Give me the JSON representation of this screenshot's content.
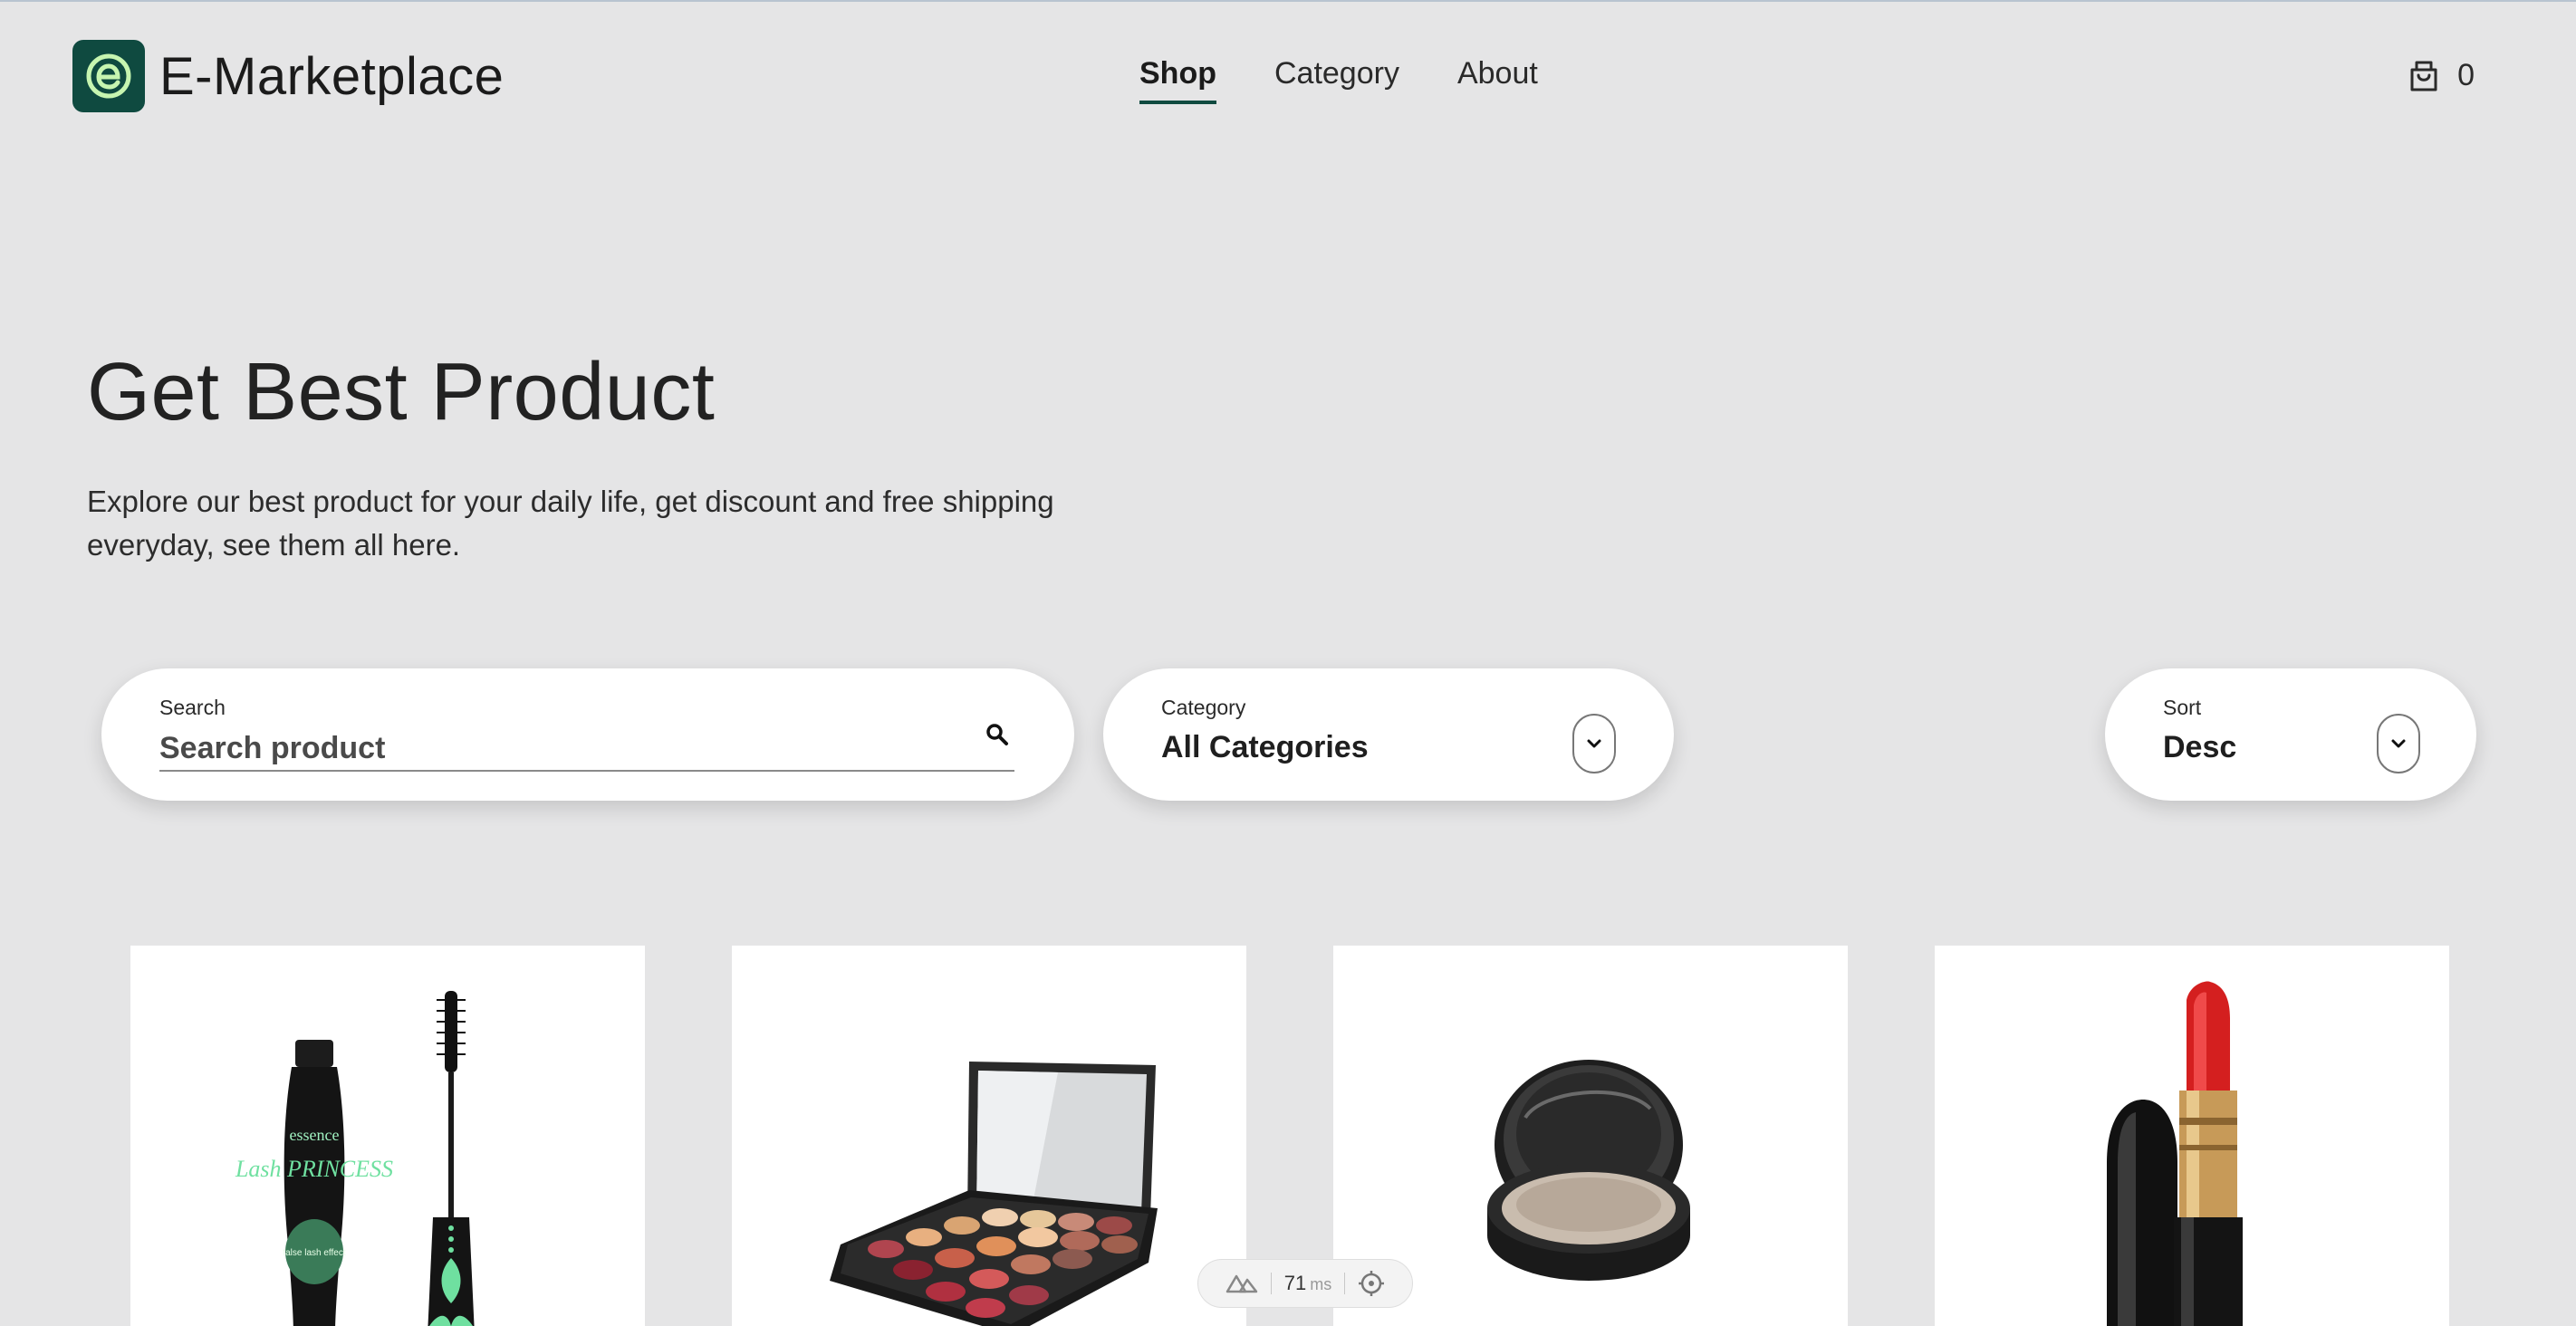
{
  "header": {
    "brand": "E-Marketplace",
    "nav": [
      {
        "label": "Shop",
        "active": true
      },
      {
        "label": "Category",
        "active": false
      },
      {
        "label": "About",
        "active": false
      }
    ],
    "cart_count": "0",
    "accent_color": "#0f4a40"
  },
  "hero": {
    "title": "Get Best Product",
    "subtitle": "Explore our best product for your daily life, get discount and free shipping everyday, see them all here."
  },
  "filters": {
    "search_label": "Search",
    "search_placeholder": "Search product",
    "category_label": "Category",
    "category_value": "All Categories",
    "sort_label": "Sort",
    "sort_value": "Desc"
  },
  "products": [
    {
      "image": "mascara-image",
      "brand_text": "essence",
      "name_text": "Lash PRINCESS",
      "badge_text": "false lash effect"
    },
    {
      "image": "eyeshadow-palette-image"
    },
    {
      "image": "powder-compact-image"
    },
    {
      "image": "red-lipstick-image"
    }
  ],
  "perf_badge": {
    "value": "71",
    "unit": "ms"
  }
}
